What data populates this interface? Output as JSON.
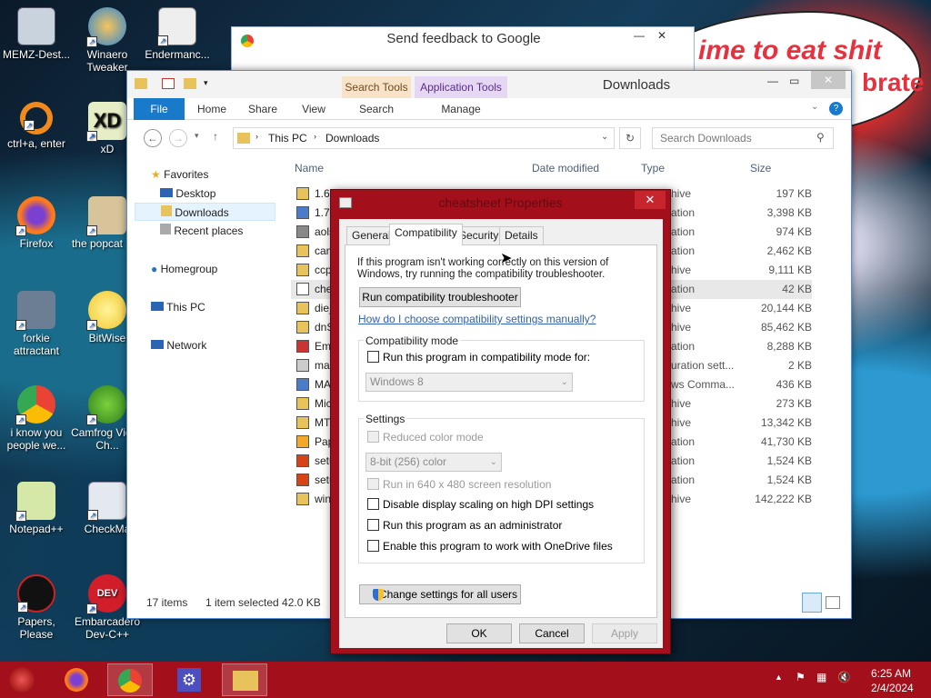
{
  "desktop": {
    "icons": [
      {
        "label": "MEMZ-Dest..."
      },
      {
        "label": "Winaero Tweaker"
      },
      {
        "label": "Endermanc..."
      },
      {
        "label": "ctrl+a, enter"
      },
      {
        "label": "xD"
      },
      {
        "label": "Firefox"
      },
      {
        "label": "the popcat shit"
      },
      {
        "label": "forkie attractant"
      },
      {
        "label": "BitWise"
      },
      {
        "label": "i know you people we..."
      },
      {
        "label": "Camfrog Video Ch..."
      },
      {
        "label": "Notepad++"
      },
      {
        "label": "CheckMa"
      },
      {
        "label": "Papers, Please"
      },
      {
        "label": "Embarcadero Dev-C++"
      }
    ],
    "bubble_line1": "ime to eat shit",
    "bubble_line2": "brate"
  },
  "chrome_window": {
    "title": "Send feedback to Google"
  },
  "explorer": {
    "title": "Downloads",
    "contextual_tab_search": "Search Tools",
    "contextual_tab_app": "Application Tools",
    "ribbon_tabs": [
      "File",
      "Home",
      "Share",
      "View",
      "Search",
      "Manage"
    ],
    "address": {
      "root": "This PC",
      "current": "Downloads"
    },
    "search_placeholder": "Search Downloads",
    "nav": {
      "favorites": "Favorites",
      "desktop": "Desktop",
      "downloads": "Downloads",
      "recent": "Recent places",
      "homegroup": "Homegroup",
      "thispc": "This PC",
      "network": "Network"
    },
    "columns": {
      "name": "Name",
      "date": "Date modified",
      "type": "Type",
      "size": "Size"
    },
    "files": [
      {
        "name": "1.6.",
        "type": "hive",
        "size": "197 KB"
      },
      {
        "name": "1.7.",
        "type": "ation",
        "size": "3,398 KB"
      },
      {
        "name": "aols",
        "type": "ation",
        "size": "974 KB"
      },
      {
        "name": "cam",
        "type": "ation",
        "size": "2,462 KB"
      },
      {
        "name": "ccp",
        "type": "hive",
        "size": "9,111 KB"
      },
      {
        "name": "che",
        "type": "ation",
        "size": "42 KB"
      },
      {
        "name": "die_",
        "type": "hive",
        "size": "20,144 KB"
      },
      {
        "name": "dnS",
        "type": "hive",
        "size": "85,462 KB"
      },
      {
        "name": "Emb",
        "type": "ation",
        "size": "8,288 KB"
      },
      {
        "name": "mai",
        "type": "uration sett...",
        "size": "2 KB"
      },
      {
        "name": "MA",
        "type": "ws Comma...",
        "size": "436 KB"
      },
      {
        "name": "Mic",
        "type": "hive",
        "size": "273 KB"
      },
      {
        "name": "MT",
        "type": "hive",
        "size": "13,342 KB"
      },
      {
        "name": "Pap",
        "type": "ation",
        "size": "41,730 KB"
      },
      {
        "name": "setu",
        "type": "ation",
        "size": "1,524 KB"
      },
      {
        "name": "setu",
        "type": "ation",
        "size": "1,524 KB"
      },
      {
        "name": "win",
        "type": "hive",
        "size": "142,222 KB"
      }
    ],
    "status": {
      "count": "17 items",
      "selected": "1 item selected  42.0 KB"
    }
  },
  "properties": {
    "title": "cheatsheet Properties",
    "tabs": [
      "General",
      "Compatibility",
      "Security",
      "Details"
    ],
    "intro": "If this program isn't working correctly on this version of Windows, try running the compatibility troubleshooter.",
    "troubleshoot_btn": "Run compatibility troubleshooter",
    "manual_link": "How do I choose compatibility settings manually?",
    "compat_group": "Compatibility mode",
    "compat_check": "Run this program in compatibility mode for:",
    "compat_os": "Windows 8",
    "settings_group": "Settings",
    "reduced_color": "Reduced color mode",
    "color_value": "8-bit (256) color",
    "run640": "Run in 640 x 480 screen resolution",
    "dpi": "Disable display scaling on high DPI settings",
    "admin": "Run this program as an administrator",
    "onedrive": "Enable this program to work with OneDrive files",
    "all_users_btn": "Change settings for all users",
    "ok": "OK",
    "cancel": "Cancel",
    "apply": "Apply"
  },
  "taskbar": {
    "time": "6:25 AM",
    "date": "2/4/2024"
  }
}
